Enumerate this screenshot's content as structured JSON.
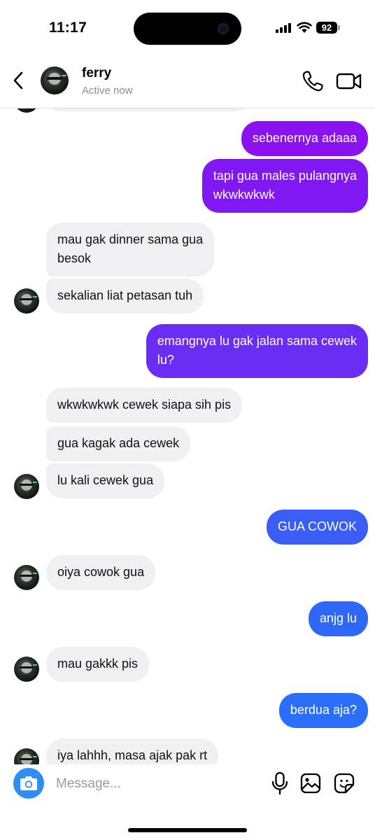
{
  "status_bar": {
    "time": "11:17",
    "battery": "92"
  },
  "header": {
    "name": "ferry",
    "status": "Active now",
    "icons": [
      "chevron-left-icon",
      "avatar",
      "phone-icon",
      "video-camera-icon"
    ]
  },
  "colors": {
    "incoming_bubble": "#f0f0f2",
    "outgoing_purple": "#8a12f0",
    "outgoing_violet": "#6a2df5",
    "outgoing_blue": "#3b5df7",
    "outgoing_light_blue": "#2a6ff9",
    "camera_button": "#2d8ef8"
  },
  "messages": [
    {
      "from": "me",
      "text": "sebenernya adaaa"
    },
    {
      "from": "me",
      "text": "tapi gua males pulangnya wkwkwkwk",
      "lines": [
        "tapi gua males pulangnya",
        "wkwkwkwk"
      ]
    },
    {
      "from": "them",
      "text": "mau gak dinner sama gua besok",
      "lines": [
        "mau gak dinner sama gua",
        "besok"
      ]
    },
    {
      "from": "them",
      "text": "sekalian liat petasan tuh"
    },
    {
      "from": "me",
      "text": "emangnya lu gak jalan sama cewek lu?",
      "lines": [
        "emangnya lu gak jalan sama cewek",
        "lu?"
      ]
    },
    {
      "from": "them",
      "text": "wkwkwkwk cewek siapa sih pis"
    },
    {
      "from": "them",
      "text": "gua kagak ada cewek"
    },
    {
      "from": "them",
      "text": "lu kali cewek gua"
    },
    {
      "from": "me",
      "text": "GUA COWOK"
    },
    {
      "from": "them",
      "text": "oiya cowok gua"
    },
    {
      "from": "me",
      "text": "anjg lu"
    },
    {
      "from": "them",
      "text": "mau gakkk pis"
    },
    {
      "from": "me",
      "text": "berdua aja?"
    },
    {
      "from": "them",
      "text": "iya lahhh, masa ajak pak rt"
    }
  ],
  "composer": {
    "placeholder": "Message...",
    "icons": [
      "camera-icon",
      "microphone-icon",
      "image-icon",
      "sticker-icon"
    ]
  }
}
